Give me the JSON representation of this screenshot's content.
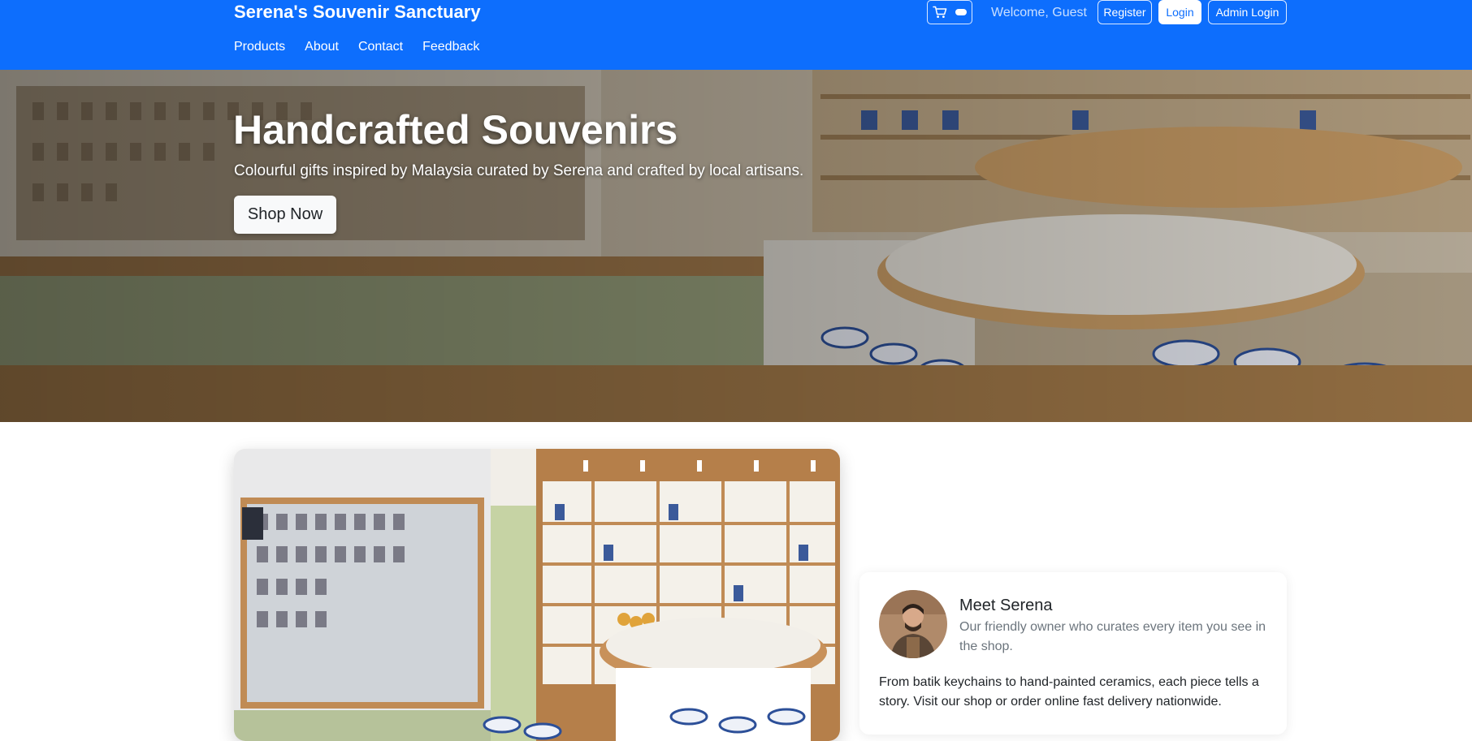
{
  "navbar": {
    "brand": "Serena's Souvenir Sanctuary",
    "links": [
      "Products",
      "About",
      "Contact",
      "Feedback"
    ],
    "cart_icon": "cart-icon",
    "welcome": "Welcome, Guest",
    "register_label": "Register",
    "login_label": "Login",
    "admin_login_label": "Admin Login"
  },
  "hero": {
    "title": "Handcrafted Souvenirs",
    "subtitle": "Colourful gifts inspired by Malaysia curated by Serena and crafted by local artisans.",
    "cta_label": "Shop Now"
  },
  "about": {
    "owner_heading": "Meet Serena",
    "owner_tagline": "Our friendly owner who curates every item you see in the shop.",
    "description": "From batik keychains to hand-painted ceramics, each piece tells a story. Visit our shop or order online fast delivery nationwide."
  },
  "colors": {
    "primary": "#0d6efd",
    "light_button": "#f8f9fa",
    "muted_text": "#6c757d",
    "body_text": "#212529"
  }
}
